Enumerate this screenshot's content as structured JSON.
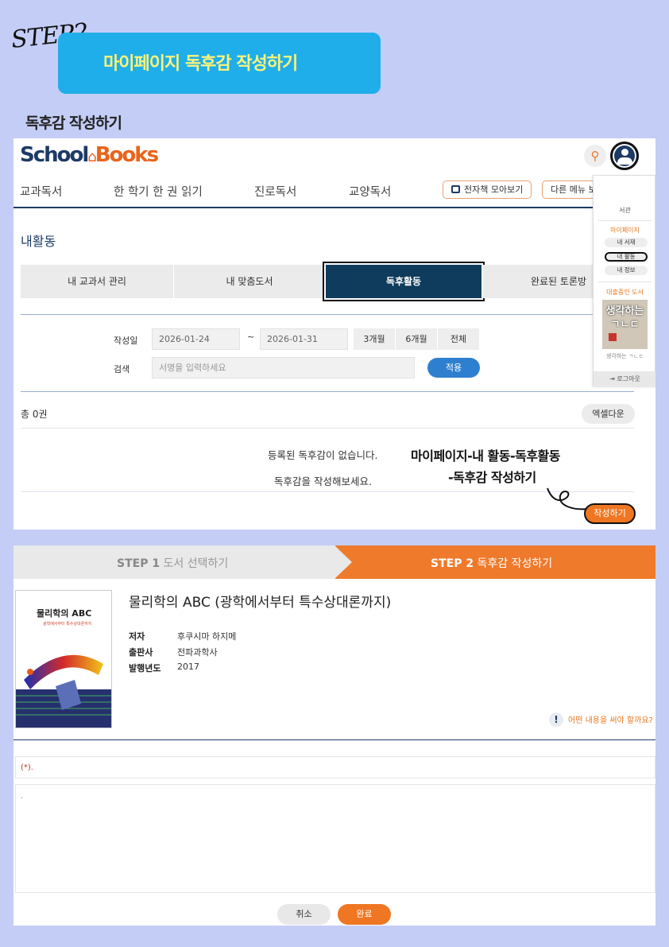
{
  "header": {
    "step_script": "STEP2",
    "banner_title": "마이페이지 독후감 작성하기",
    "section_title": "독후감 작성하기"
  },
  "site": {
    "logo_school": "School",
    "logo_books": "Books",
    "nav": [
      "교과독서",
      "한 학기 한 권 읽기",
      "진로독서",
      "교양독서"
    ],
    "ebook_button": "전자책 모아보기",
    "other_menu_button": "다른 메뉴 보"
  },
  "dropdown": {
    "title": "서관",
    "mypage": "마이페이지",
    "items": [
      "내 서재",
      "내 활동",
      "내 정보"
    ],
    "borrowing_label": "대출중인 도서",
    "book_caption": "생각하는 ㄱㄴㄷ",
    "book_cover_text": "생각하는 ㄱㄴㄷ",
    "logout": "로그아웃"
  },
  "activity": {
    "title": "내활동",
    "tabs": [
      "내 교과서 관리",
      "내 맞춤도서",
      "독후활동",
      "완료된 토론방"
    ],
    "active_tab": 2,
    "filter": {
      "date_label": "작성일",
      "date_from": "2026-01-24",
      "tilde": "~",
      "date_to": "2026-01-31",
      "periods": [
        "3개월",
        "6개월",
        "전체"
      ],
      "search_label": "검색",
      "search_placeholder": "서명을 입력하세요",
      "apply": "적용"
    },
    "total": "총 0권",
    "excel": "엑셀다운",
    "empty_line1": "등록된 독후감이 없습니다.",
    "empty_line2": "독후감을 작성해보세요.",
    "annotation_line1": "마이페이지-내 활동-독후활동",
    "annotation_line2": "-독후감 작성하기",
    "write_button": "작성하기"
  },
  "write": {
    "step1_bold": "STEP 1",
    "step1_text": "도서 선택하기",
    "step2_bold": "STEP 2",
    "step2_text": "독후감 작성하기",
    "book_title": "물리학의 ABC (광학에서부터 특수상대론까지)",
    "cover_title": "물리학의 ABC",
    "cover_subtitle": "광학에서부터 특수상대론까지",
    "meta": [
      {
        "k": "저자",
        "v": "후쿠시마 하지메"
      },
      {
        "k": "출판사",
        "v": "전파과학사"
      },
      {
        "k": "발행년도",
        "v": "2017"
      }
    ],
    "help_text": "어떤 내용을 써야 할까요?",
    "required_note": "(*).",
    "content_placeholder": ".",
    "cancel": "취소",
    "done": "완료"
  },
  "colors": {
    "background": "#c4cdf6",
    "banner": "#1faee9",
    "banner_text": "#f9f37a",
    "navy": "#1d3a66",
    "orange": "#ef7622",
    "apply_blue": "#2e7fd0"
  }
}
